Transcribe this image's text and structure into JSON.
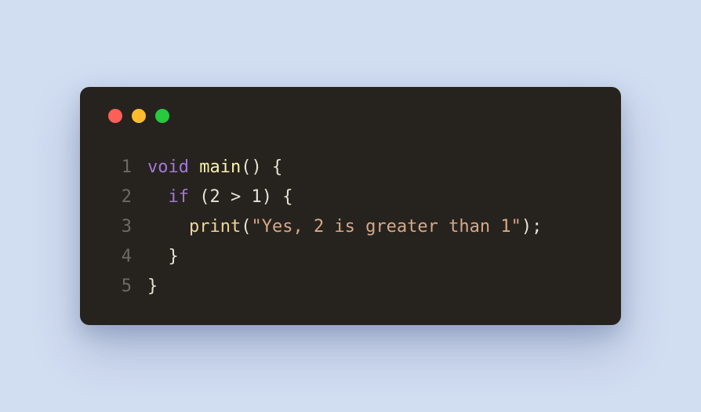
{
  "trafficLights": [
    "red",
    "yellow",
    "green"
  ],
  "code": {
    "lines": [
      {
        "num": "1",
        "tokens": [
          {
            "t": "void",
            "c": "tok-keyword"
          },
          {
            "t": " ",
            "c": "tok-plain"
          },
          {
            "t": "main",
            "c": "tok-fn"
          },
          {
            "t": "() {",
            "c": "tok-plain"
          }
        ]
      },
      {
        "num": "2",
        "tokens": [
          {
            "t": "  ",
            "c": "tok-plain"
          },
          {
            "t": "if",
            "c": "tok-keyword"
          },
          {
            "t": " (",
            "c": "tok-plain"
          },
          {
            "t": "2",
            "c": "tok-num"
          },
          {
            "t": " > ",
            "c": "tok-op"
          },
          {
            "t": "1",
            "c": "tok-num"
          },
          {
            "t": ") {",
            "c": "tok-plain"
          }
        ]
      },
      {
        "num": "3",
        "tokens": [
          {
            "t": "    ",
            "c": "tok-plain"
          },
          {
            "t": "print",
            "c": "tok-call"
          },
          {
            "t": "(",
            "c": "tok-plain"
          },
          {
            "t": "\"Yes, 2 is greater than 1\"",
            "c": "tok-string"
          },
          {
            "t": ");",
            "c": "tok-plain"
          }
        ]
      },
      {
        "num": "4",
        "tokens": [
          {
            "t": "  }",
            "c": "tok-plain"
          }
        ]
      },
      {
        "num": "5",
        "tokens": [
          {
            "t": "}",
            "c": "tok-plain"
          }
        ]
      }
    ]
  }
}
